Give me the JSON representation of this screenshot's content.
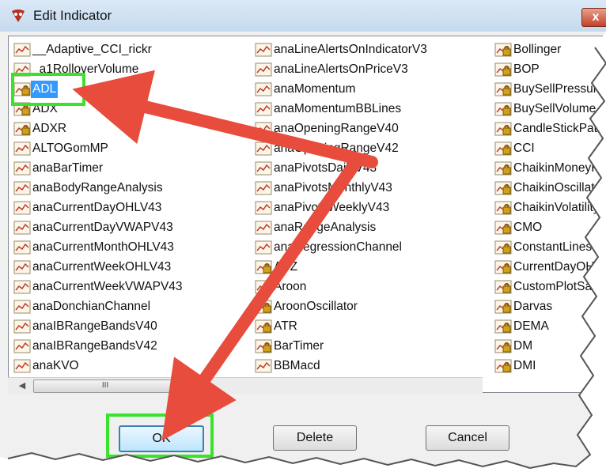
{
  "window": {
    "title": "Edit Indicator",
    "close_label": "x"
  },
  "list": {
    "col1": [
      {
        "label": "__Adaptive_CCI_rickr",
        "icon": "chart-icon"
      },
      {
        "label": "_a1RolloverVolume",
        "icon": "chart-icon"
      },
      {
        "label": "ADL",
        "icon": "lock-chart-icon",
        "selected": true
      },
      {
        "label": "ADX",
        "icon": "lock-chart-icon"
      },
      {
        "label": "ADXR",
        "icon": "lock-chart-icon"
      },
      {
        "label": "ALTOGomMP",
        "icon": "chart-icon"
      },
      {
        "label": "anaBarTimer",
        "icon": "chart-icon"
      },
      {
        "label": "anaBodyRangeAnalysis",
        "icon": "chart-icon"
      },
      {
        "label": "anaCurrentDayOHLV43",
        "icon": "chart-icon"
      },
      {
        "label": "anaCurrentDayVWAPV43",
        "icon": "chart-icon"
      },
      {
        "label": "anaCurrentMonthOHLV43",
        "icon": "chart-icon"
      },
      {
        "label": "anaCurrentWeekOHLV43",
        "icon": "chart-icon"
      },
      {
        "label": "anaCurrentWeekVWAPV43",
        "icon": "chart-icon"
      },
      {
        "label": "anaDonchianChannel",
        "icon": "chart-icon"
      },
      {
        "label": "anaIBRangeBandsV40",
        "icon": "chart-icon"
      },
      {
        "label": "anaIBRangeBandsV42",
        "icon": "chart-icon"
      },
      {
        "label": "anaKVO",
        "icon": "chart-icon"
      }
    ],
    "col2": [
      {
        "label": "anaLineAlertsOnIndicatorV3",
        "icon": "chart-icon"
      },
      {
        "label": "anaLineAlertsOnPriceV3",
        "icon": "chart-icon"
      },
      {
        "label": "anaMomentum",
        "icon": "chart-icon"
      },
      {
        "label": "anaMomentumBBLines",
        "icon": "chart-icon"
      },
      {
        "label": "anaOpeningRangeV40",
        "icon": "chart-icon"
      },
      {
        "label": "anaOpeningRangeV42",
        "icon": "chart-icon"
      },
      {
        "label": "anaPivotsDailyV43",
        "icon": "chart-icon"
      },
      {
        "label": "anaPivotsMonthlyV43",
        "icon": "chart-icon"
      },
      {
        "label": "anaPivotsWeeklyV43",
        "icon": "chart-icon"
      },
      {
        "label": "anaRangeAnalysis",
        "icon": "chart-icon"
      },
      {
        "label": "anaRegressionChannel",
        "icon": "chart-icon"
      },
      {
        "label": "APZ",
        "icon": "lock-chart-icon"
      },
      {
        "label": "Aroon",
        "icon": "lock-chart-icon"
      },
      {
        "label": "AroonOscillator",
        "icon": "lock-chart-icon"
      },
      {
        "label": "ATR",
        "icon": "lock-chart-icon"
      },
      {
        "label": "BarTimer",
        "icon": "lock-chart-icon"
      },
      {
        "label": "BBMacd",
        "icon": "chart-icon"
      }
    ],
    "col3": [
      {
        "label": "Bollinger",
        "icon": "lock-chart-icon"
      },
      {
        "label": "BOP",
        "icon": "lock-chart-icon"
      },
      {
        "label": "BuySellPressure",
        "icon": "lock-chart-icon"
      },
      {
        "label": "BuySellVolume",
        "icon": "lock-chart-icon"
      },
      {
        "label": "CandleStickPattern",
        "icon": "lock-chart-icon"
      },
      {
        "label": "CCI",
        "icon": "lock-chart-icon"
      },
      {
        "label": "ChaikinMoneyFlow",
        "icon": "lock-chart-icon"
      },
      {
        "label": "ChaikinOscillator",
        "icon": "lock-chart-icon"
      },
      {
        "label": "ChaikinVolatility",
        "icon": "lock-chart-icon"
      },
      {
        "label": "CMO",
        "icon": "lock-chart-icon"
      },
      {
        "label": "ConstantLines",
        "icon": "lock-chart-icon"
      },
      {
        "label": "CurrentDayOHL",
        "icon": "lock-chart-icon"
      },
      {
        "label": "CustomPlotSample",
        "icon": "lock-chart-icon"
      },
      {
        "label": "Darvas",
        "icon": "lock-chart-icon"
      },
      {
        "label": "DEMA",
        "icon": "lock-chart-icon"
      },
      {
        "label": "DM",
        "icon": "lock-chart-icon"
      },
      {
        "label": "DMI",
        "icon": "lock-chart-icon"
      }
    ]
  },
  "scrollbar": {
    "thumb_grip": "III"
  },
  "buttons": {
    "ok": "OK",
    "delete": "Delete",
    "cancel": "Cancel"
  },
  "colors": {
    "highlight_box": "#39e32a",
    "arrow": "#e74c3c",
    "selection": "#3399ff"
  }
}
